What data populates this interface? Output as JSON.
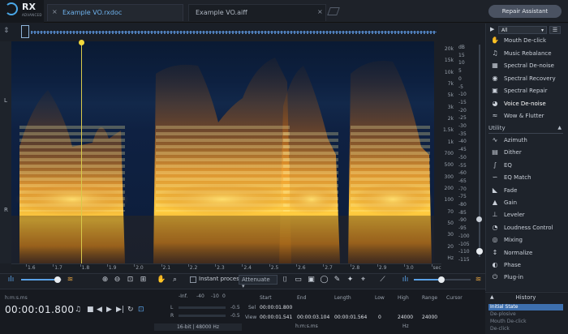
{
  "app": {
    "logo": "RX",
    "edition": "ADVANCED"
  },
  "tabs": [
    {
      "label": "Example VO.rxdoc",
      "close": "×"
    },
    {
      "label": "Example VO.aiff",
      "close": "×"
    }
  ],
  "repair_button": "Repair Assistant",
  "channels": {
    "left": "L",
    "right": "R"
  },
  "freq_labels": [
    "20k",
    "15k",
    "10k",
    "7k",
    "5k",
    "3k",
    "2k",
    "1.5k",
    "1k",
    "700",
    "500",
    "300",
    "200",
    "100",
    "70",
    "50",
    "30",
    "20",
    "Hz"
  ],
  "db_labels": [
    "dB",
    "15",
    "10",
    "5",
    "0",
    "-5",
    "-10",
    "-15",
    "-20",
    "-25",
    "-30",
    "-35",
    "-40",
    "-45",
    "-50",
    "-55",
    "-60",
    "-65",
    "-70",
    "-75",
    "-80",
    "-85",
    "-90",
    "-95",
    "-100",
    "-105",
    "-110",
    "-115"
  ],
  "time_labels": [
    "1.6",
    "1.7",
    "1.8",
    "1.9",
    "2.0",
    "2.1",
    "2.2",
    "2.3",
    "2.4",
    "2.5",
    "2.6",
    "2.7",
    "2.8",
    "2.9",
    "3.0",
    "sec"
  ],
  "toolbar": {
    "instant_process": "Instant process",
    "attenuate": "Attenuate"
  },
  "transport": {
    "format_label": "h:m:s.ms",
    "timecode": "00:00:01.800"
  },
  "meter": {
    "inf": "-Inf.",
    "m40": "-40",
    "m10": "-10",
    "zero": "0",
    "ch_l": "L",
    "ch_r": "R",
    "l_peak": "-0.5",
    "r_peak": "-0.5",
    "format": "16-bit | 48000 Hz"
  },
  "selection": {
    "start_h": "Start",
    "end_h": "End",
    "length_h": "Length",
    "low_h": "Low",
    "high_h": "High",
    "range_h": "Range",
    "cursor_h": "Cursor",
    "sel_label": "Sel",
    "view_label": "View",
    "sel_start": "00:00:01.800",
    "view_start": "00:00:01.541",
    "view_end": "00:00:03.104",
    "view_length": "00:00:01.564",
    "view_low": "0",
    "view_high": "24000",
    "view_range": "24000",
    "time_unit": "h:m:s.ms",
    "freq_unit": "Hz"
  },
  "panel": {
    "filter": "All",
    "modules": [
      {
        "icon": "✋",
        "label": "Mouth De-click"
      },
      {
        "icon": "♫",
        "label": "Music Rebalance"
      },
      {
        "icon": "▦",
        "label": "Spectral De-noise"
      },
      {
        "icon": "◉",
        "label": "Spectral Recovery"
      },
      {
        "icon": "▣",
        "label": "Spectral Repair"
      },
      {
        "icon": "◕",
        "label": "Voice De-noise"
      },
      {
        "icon": "≈",
        "label": "Wow & Flutter"
      }
    ],
    "utility_header": "Utility",
    "utilities": [
      {
        "icon": "∿",
        "label": "Azimuth"
      },
      {
        "icon": "▤",
        "label": "Dither"
      },
      {
        "icon": "∫",
        "label": "EQ"
      },
      {
        "icon": "∽",
        "label": "EQ Match"
      },
      {
        "icon": "◣",
        "label": "Fade"
      },
      {
        "icon": "▲",
        "label": "Gain"
      },
      {
        "icon": "⊥",
        "label": "Leveler"
      },
      {
        "icon": "◔",
        "label": "Loudness Control"
      },
      {
        "icon": "◎",
        "label": "Mixing"
      },
      {
        "icon": "↕",
        "label": "Normalize"
      },
      {
        "icon": "◐",
        "label": "Phase"
      },
      {
        "icon": "⏻",
        "label": "Plug-in"
      }
    ]
  },
  "history": {
    "title": "History",
    "items": [
      "Initial State",
      "De-plosive",
      "Mouth De-click",
      "De-click"
    ]
  }
}
